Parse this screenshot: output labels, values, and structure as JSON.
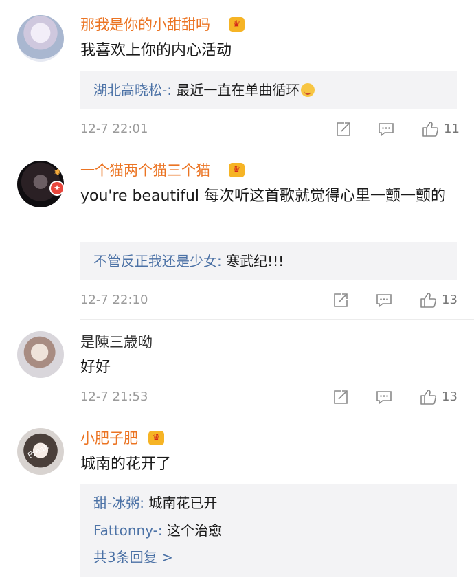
{
  "comments": [
    {
      "username": "那我是你的小甜甜吗",
      "text": "我喜欢上你的内心活动",
      "replies": [
        {
          "user": "湖北高晓松-",
          "text": "最近一直在单曲循环"
        }
      ],
      "timestamp": "12-7 22:01",
      "likes": "11"
    },
    {
      "username": "一个猫两个猫三个猫",
      "text": "you're beautiful   每次听这首歌就觉得心里一颤一颤的",
      "replies": [
        {
          "user": "不管反正我还是少女",
          "text": "寒武纪!!!"
        }
      ],
      "timestamp": "12-7 22:10",
      "likes": "13"
    },
    {
      "username": "是陳三歳呦",
      "text": "好好",
      "timestamp": "12-7 21:53",
      "likes": "13"
    },
    {
      "username": "小肥子肥",
      "avatar_text": "Freak",
      "text": "城南的花开了",
      "replies": [
        {
          "user": "甜-冰粥",
          "text": "城南花已开"
        },
        {
          "user": "Fattonny-",
          "text": "这个治愈"
        }
      ],
      "more_replies": "共3条回复 >"
    }
  ],
  "reply_separator": ":",
  "icons": {
    "vip_badge": "crown-icon",
    "reply_emoji": "emoji-icon",
    "verified_badge": "verified-badge-icon",
    "actions": [
      "repost-icon",
      "comment-icon",
      "like-icon"
    ]
  },
  "colors": {
    "vip_name": "#eb7423",
    "reply_link": "#4c72a6",
    "crown_bg": "#f6b425",
    "verified_red": "#e8463c",
    "reply_bg": "#f3f3f5",
    "meta_gray": "#9b9b9b"
  }
}
